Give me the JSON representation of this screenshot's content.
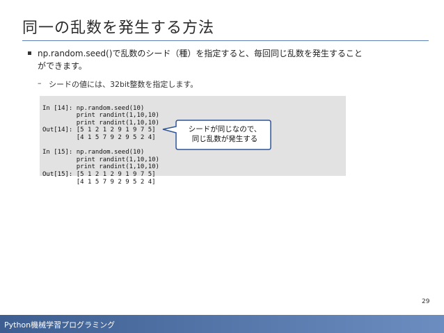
{
  "title": "同一の乱数を発生する方法",
  "bullet": {
    "line1": "np.random.seed()で乱数のシード（種）を指定すると、毎回同じ乱数を発生すること",
    "line2": "ができます。"
  },
  "sub_bullet": {
    "dash": "–",
    "text": "シードの値には、32bit整数を指定します。"
  },
  "code_lines": [
    "In [14]: np.random.seed(10)",
    "         print randint(1,10,10)",
    "         print randint(1,10,10)",
    "Out[14]: [5 1 2 1 2 9 1 9 7 5]",
    "         [4 1 5 7 9 2 9 5 2 4]",
    "",
    "In [15]: np.random.seed(10)",
    "         print randint(1,10,10)",
    "         print randint(1,10,10)",
    "Out[15]: [5 1 2 1 2 9 1 9 7 5]",
    "         [4 1 5 7 9 2 9 5 2 4]"
  ],
  "callout": {
    "line1": "シードが同じなので、",
    "line2": "同じ乱数が発生する"
  },
  "page_number": "29",
  "footer": "Python機械学習プログラミング",
  "colors": {
    "footer_start": "#3d5e91",
    "footer_end": "#6b8dc0",
    "rule": "#5b7fb5",
    "code_bg": "#e2e2e2",
    "callout_border": "#2f5597"
  }
}
